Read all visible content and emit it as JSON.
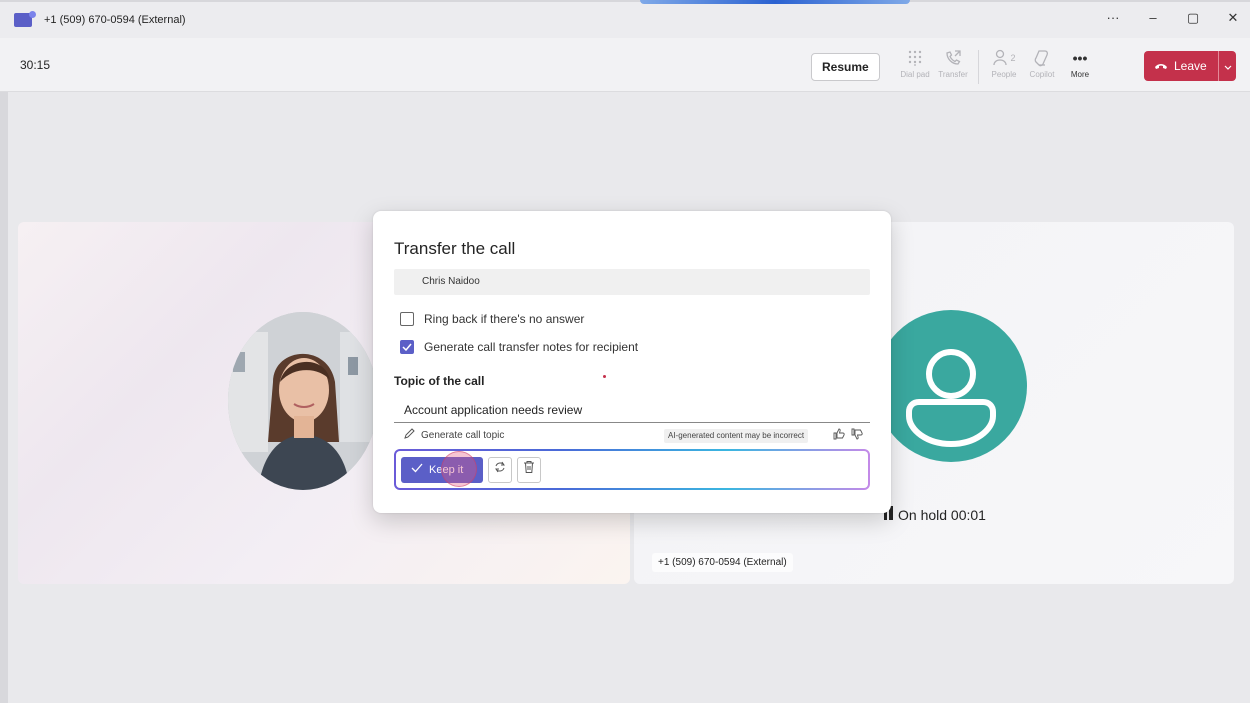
{
  "window": {
    "title": "+1 (509) 670-0594 (External)",
    "controls": {
      "more": "···",
      "minimize": "–",
      "maximize": "▢",
      "close": "✕"
    }
  },
  "toolbar": {
    "timer": "30:15",
    "resume_label": "Resume",
    "items": [
      {
        "label": "Dial pad",
        "icon": "dialpad-icon",
        "enabled": false
      },
      {
        "label": "Transfer",
        "icon": "transfer-icon",
        "enabled": false
      },
      {
        "label": "People",
        "icon": "people-icon",
        "count": "2",
        "enabled": false
      },
      {
        "label": "Copilot",
        "icon": "copilot-icon",
        "enabled": false
      },
      {
        "label": "More",
        "icon": "more-icon",
        "enabled": true
      }
    ],
    "leave_label": "Leave",
    "leave_color": "#c4314b"
  },
  "stage": {
    "hold_status": "On hold 00:01",
    "external_label": "+1 (509) 670-0594 (External)",
    "avatar_color": "#3aa89f"
  },
  "dialog": {
    "title": "Transfer the call",
    "recipient": "Chris Naidoo",
    "ring_back_label": "Ring back if there's no answer",
    "ring_back_checked": false,
    "generate_notes_label": "Generate call transfer notes for recipient",
    "generate_notes_checked": true,
    "topic_label": "Topic of the call",
    "topic_value": "Account application needs review",
    "generate_topic_label": "Generate call topic",
    "ai_disclaimer": "AI-generated content may be incorrect",
    "keep_label": "Keep it",
    "accent_color": "#5b5fc7"
  }
}
